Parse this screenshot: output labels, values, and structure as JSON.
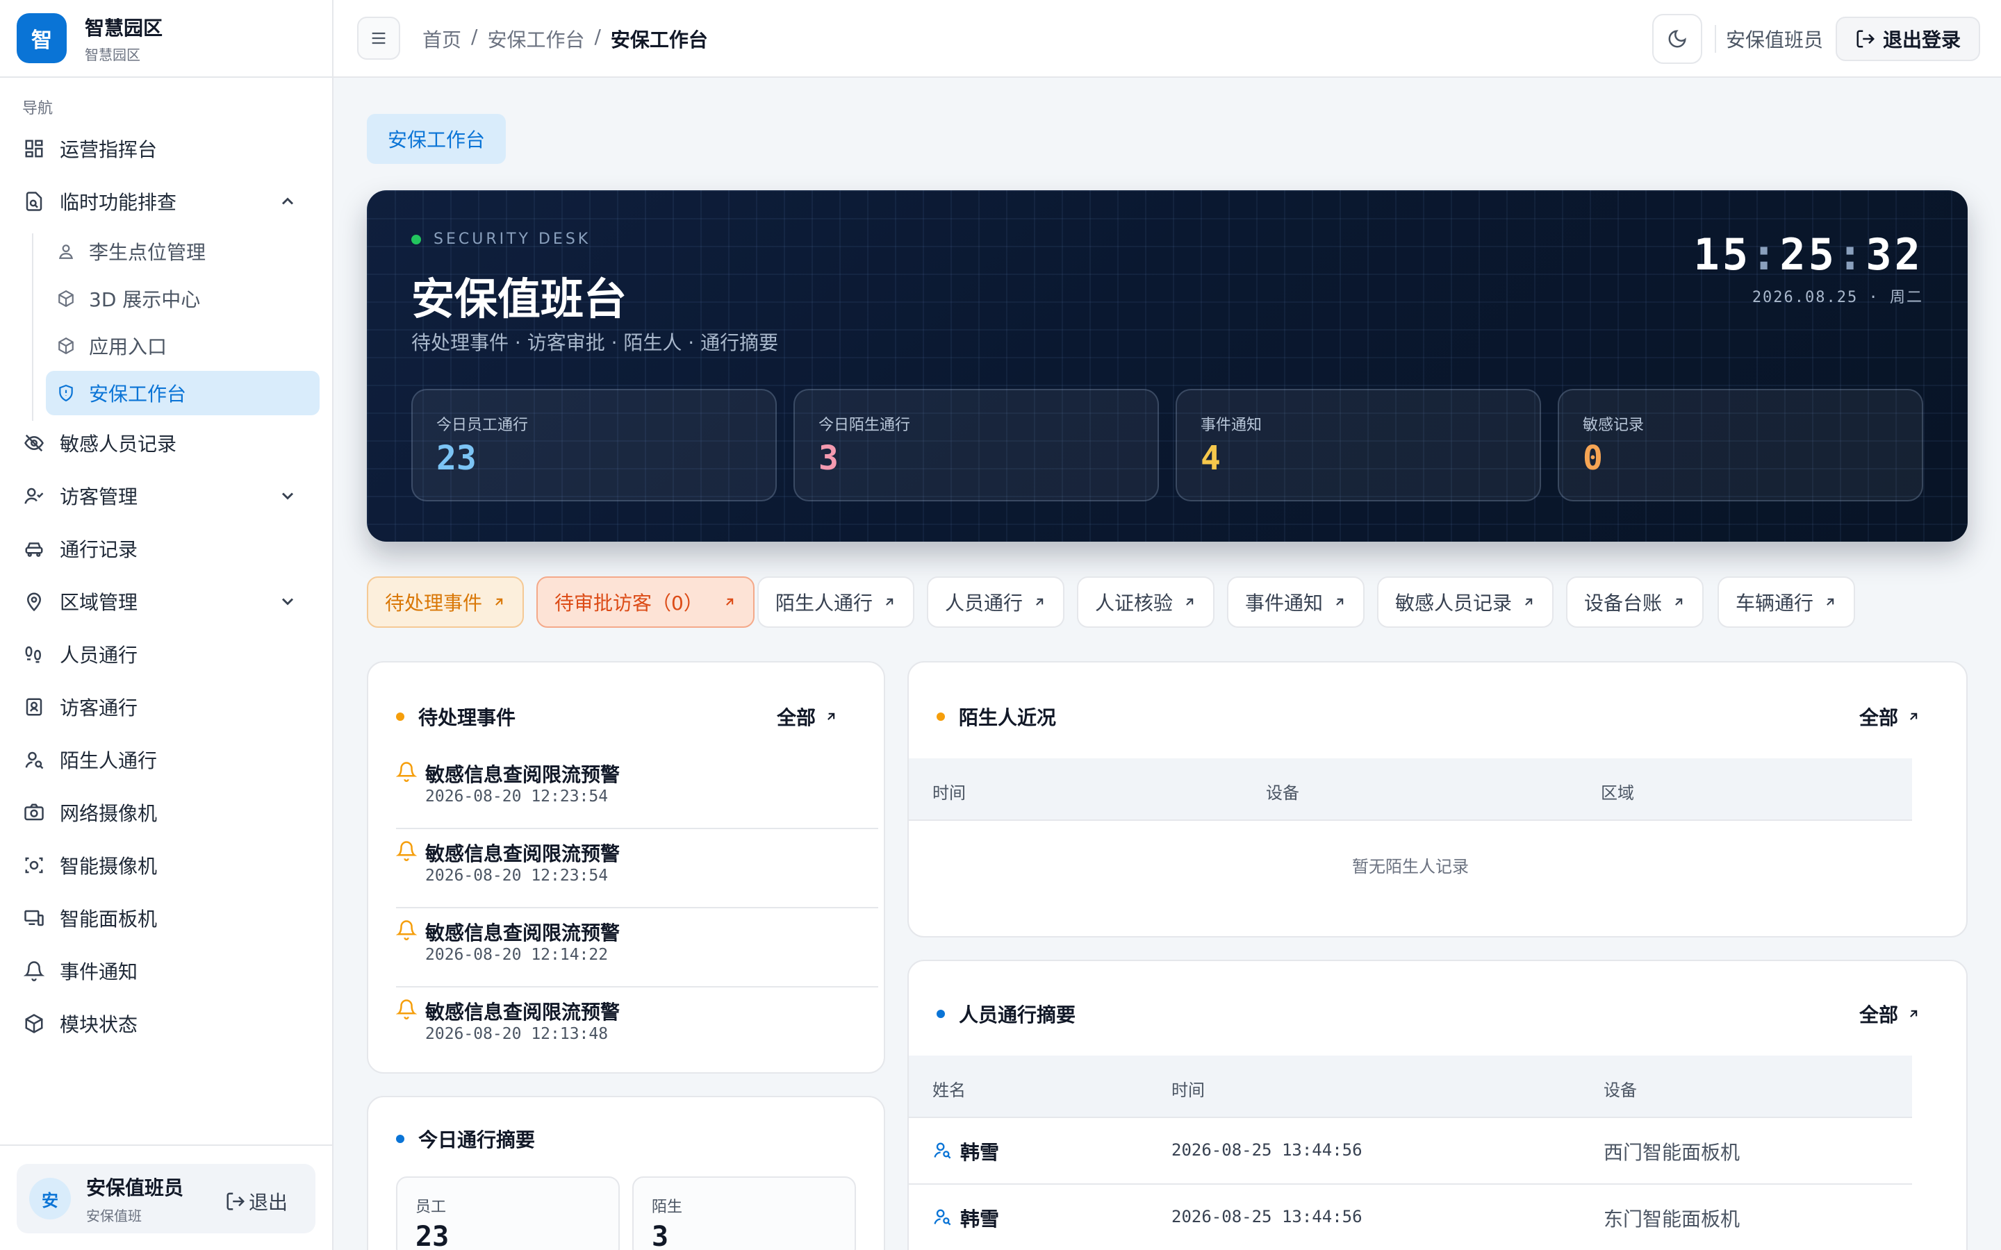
{
  "brand": {
    "logo": "智",
    "title": "智慧园区",
    "subtitle": "智慧园区"
  },
  "nav": {
    "group_label": "导航",
    "items": [
      {
        "label": "运营指挥台",
        "icon": "dashboard-icon"
      },
      {
        "label": "临时功能排查",
        "icon": "file-search-icon",
        "expanded": true
      },
      {
        "label": "敏感人员记录",
        "icon": "eye-off-icon"
      },
      {
        "label": "访客管理",
        "icon": "user-check-icon"
      },
      {
        "label": "通行记录",
        "icon": "car-icon"
      },
      {
        "label": "区域管理",
        "icon": "map-pin-icon"
      },
      {
        "label": "人员通行",
        "icon": "footprints-icon"
      },
      {
        "label": "访客通行",
        "icon": "id-badge-icon"
      },
      {
        "label": "陌生人通行",
        "icon": "user-search-icon"
      },
      {
        "label": "网络摄像机",
        "icon": "camera-icon"
      },
      {
        "label": "智能摄像机",
        "icon": "smart-camera-icon"
      },
      {
        "label": "智能面板机",
        "icon": "devices-icon"
      },
      {
        "label": "事件通知",
        "icon": "bell-icon"
      },
      {
        "label": "模块状态",
        "icon": "box-icon"
      }
    ],
    "sub_items": [
      {
        "label": "李生点位管理",
        "icon": "user-pin-icon"
      },
      {
        "label": "3D 展示中心",
        "icon": "cube-icon"
      },
      {
        "label": "应用入口",
        "icon": "cube-icon"
      },
      {
        "label": "安保工作台",
        "icon": "shield-icon",
        "active": true
      }
    ]
  },
  "sidebar_user": {
    "avatar": "安",
    "name": "安保值班员",
    "role": "安保值班",
    "logout": "退出"
  },
  "header": {
    "breadcrumbs": [
      "首页",
      "安保工作台",
      "安保工作台"
    ],
    "separator": "/",
    "user": "安保值班员",
    "logout": "退出登录"
  },
  "page_tag": "安保工作台",
  "hero": {
    "kicker": "SECURITY DESK",
    "title": "安保值班台",
    "subtitle": "待处理事件 · 访客审批 · 陌生人 · 通行摘要",
    "clock": {
      "h": "15",
      "m": "25",
      "s": "32"
    },
    "date": "2026.08.25 · 周二",
    "stats": [
      {
        "label": "今日员工通行",
        "value": "23",
        "color": "#7cc4f5"
      },
      {
        "label": "今日陌生通行",
        "value": "3",
        "color": "#f49ab0"
      },
      {
        "label": "事件通知",
        "value": "4",
        "color": "#f6c84c"
      },
      {
        "label": "敏感记录",
        "value": "0",
        "color": "#f6a554"
      }
    ]
  },
  "chips": [
    {
      "label": "待处理事件",
      "style": "warn"
    },
    {
      "label": "待审批访客（0）",
      "style": "danger"
    },
    {
      "label": "陌生人通行"
    },
    {
      "label": "人员通行"
    },
    {
      "label": "人证核验"
    },
    {
      "label": "事件通知"
    },
    {
      "label": "敏感人员记录"
    },
    {
      "label": "设备台账"
    },
    {
      "label": "车辆通行"
    }
  ],
  "pending": {
    "title": "待处理事件",
    "all": "全部",
    "items": [
      {
        "title": "敏感信息查阅限流预警",
        "time": "2026-08-20 12:23:54"
      },
      {
        "title": "敏感信息查阅限流预警",
        "time": "2026-08-20 12:23:54"
      },
      {
        "title": "敏感信息查阅限流预警",
        "time": "2026-08-20 12:14:22"
      },
      {
        "title": "敏感信息查阅限流预警",
        "time": "2026-08-20 12:13:48"
      }
    ]
  },
  "strangers": {
    "title": "陌生人近况",
    "all": "全部",
    "columns": [
      "时间",
      "设备",
      "区域"
    ],
    "empty": "暂无陌生人记录"
  },
  "passage": {
    "title": "人员通行摘要",
    "all": "全部",
    "columns": [
      "姓名",
      "时间",
      "设备"
    ],
    "rows": [
      {
        "name": "韩雪",
        "time": "2026-08-25 13:44:56",
        "device": "西门智能面板机"
      },
      {
        "name": "韩雪",
        "time": "2026-08-25 13:44:56",
        "device": "东门智能面板机"
      }
    ]
  },
  "today": {
    "title": "今日通行摘要",
    "items": [
      {
        "label": "员工",
        "value": "23"
      },
      {
        "label": "陌生",
        "value": "3"
      }
    ]
  },
  "colors": {
    "accent": "#0a74d6",
    "warn": "#d97706",
    "danger": "#dc4b16"
  }
}
